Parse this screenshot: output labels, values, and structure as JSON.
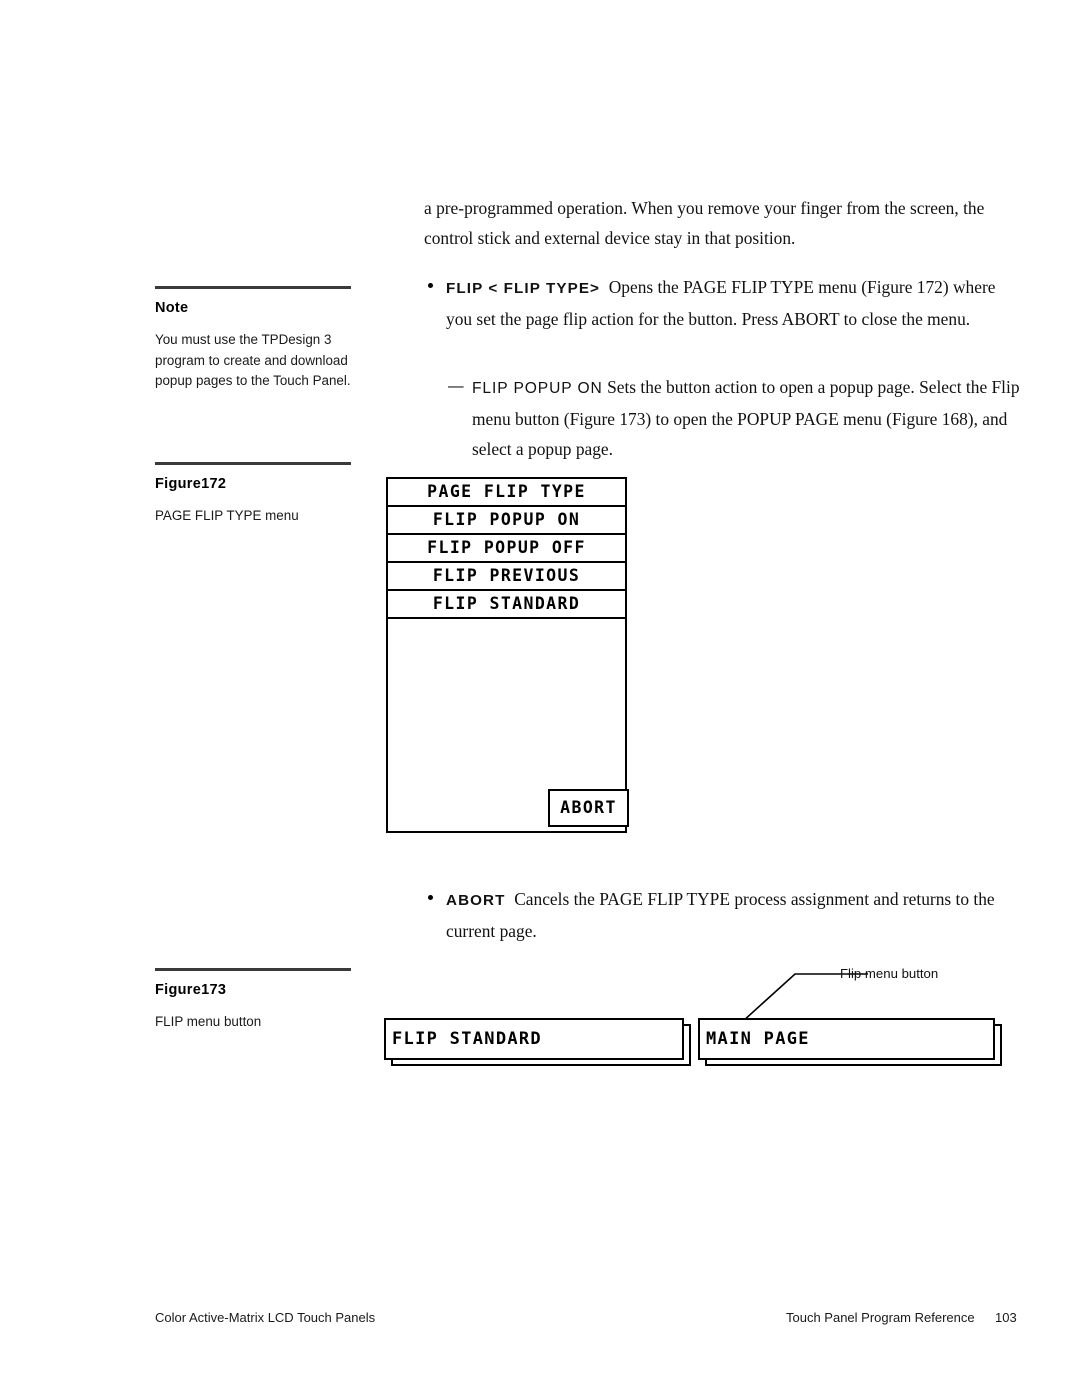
{
  "note": {
    "heading": "Note",
    "body": "You must use the TPDesign 3 program to create and download popup pages to the Touch Panel."
  },
  "figure172": {
    "label": "Figure172",
    "caption": "PAGE FLIP TYPE menu"
  },
  "figure173": {
    "label": "Figure173",
    "caption": "FLIP menu button"
  },
  "body": {
    "intro_paragraph": "a pre-programmed operation. When you remove your finger from the screen, the control stick and external device stay in that position.",
    "flip_bullet": {
      "term": "FLIP < FLIP TYPE>",
      "text": "Opens the PAGE FLIP TYPE menu (Figure 172) where you set the page flip action for the button. Press ABORT to close the menu."
    },
    "flip_popup_sub": {
      "dash": "—",
      "term": "FLIP POPUP ON",
      "text": "Sets the button action to open a popup page. Select the Flip menu button (Figure 173) to open the POPUP PAGE menu (Figure 168), and select a popup page."
    },
    "abort_bullet": {
      "term": "ABORT",
      "text": "Cancels the PAGE FLIP TYPE process assignment and returns to the current page."
    }
  },
  "lcd_menu": {
    "title": "PAGE FLIP TYPE",
    "items": [
      "FLIP POPUP ON",
      "FLIP POPUP OFF",
      "FLIP PREVIOUS",
      "FLIP STANDARD"
    ],
    "abort_label": "ABORT"
  },
  "touch_buttons": {
    "left_button": "FLIP STANDARD",
    "right_button": "MAIN PAGE",
    "callout": "Flip menu button"
  },
  "footer": {
    "left": "Color Active-Matrix LCD Touch Panels",
    "center": "Touch Panel Program Reference",
    "page": "103"
  },
  "colors": {
    "ink": "#000000",
    "rule": "#3a3a3a",
    "paper": "#ffffff"
  }
}
